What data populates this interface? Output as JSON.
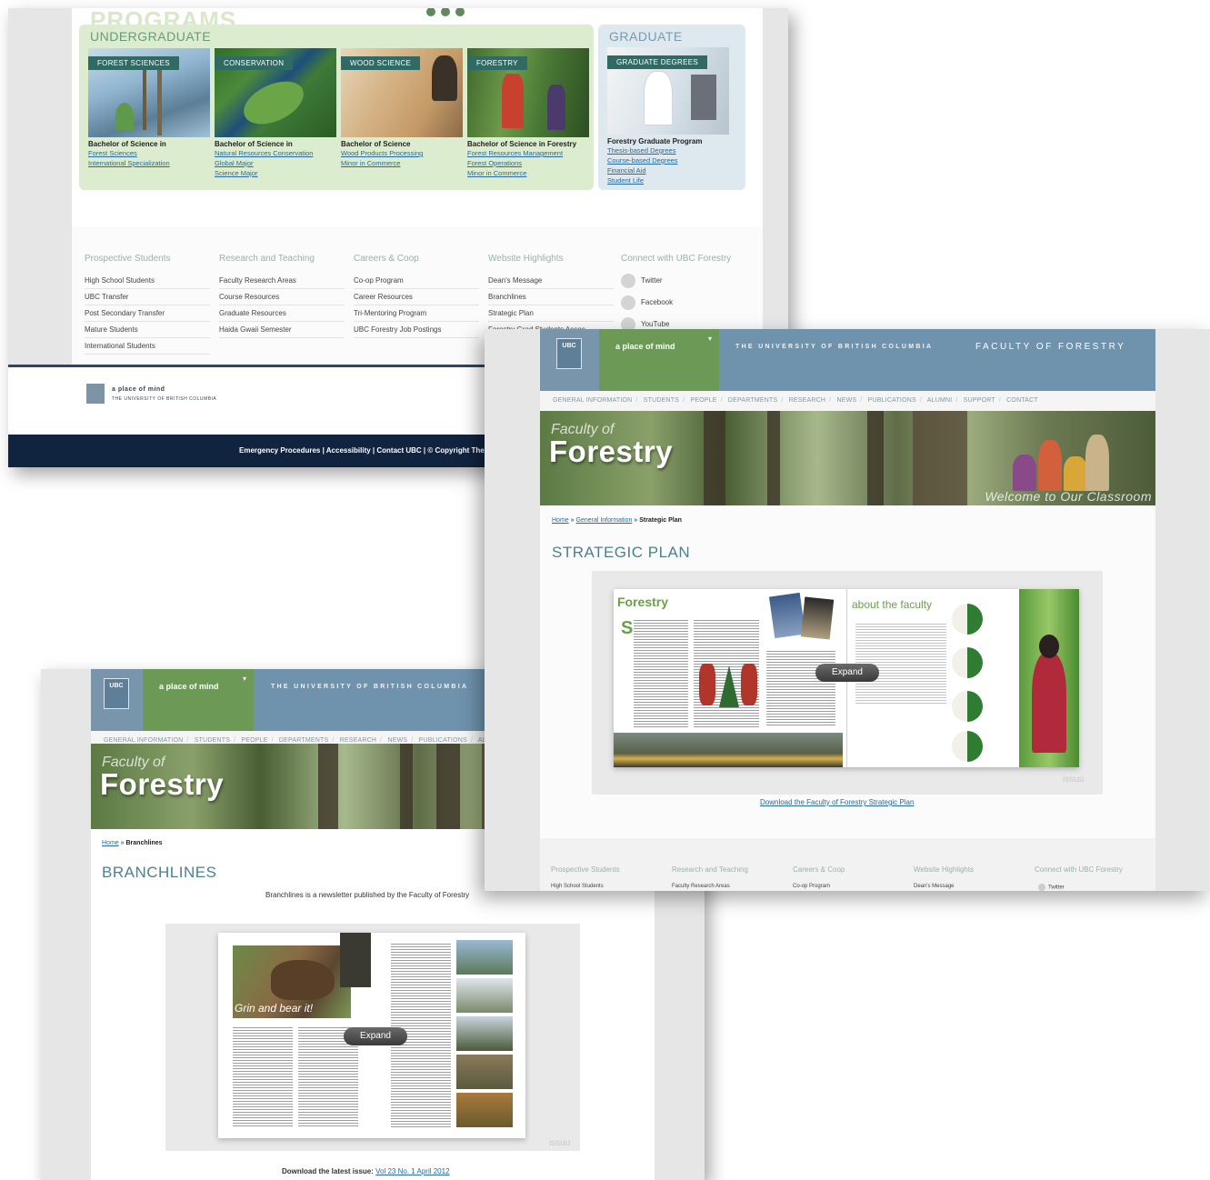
{
  "screen1": {
    "programs_heading": "PROGRAMS",
    "undergraduate": {
      "heading": "UNDERGRADUATE",
      "programs": [
        {
          "tag": "FOREST SCIENCES",
          "title": "Bachelor of Science in",
          "links": [
            "Forest Sciences",
            "International Specialization"
          ]
        },
        {
          "tag": "CONSERVATION",
          "title": "Bachelor of Science in",
          "links": [
            "Natural Resources Conservation",
            "Global Major",
            "Science Major"
          ]
        },
        {
          "tag": "WOOD SCIENCE",
          "title": "Bachelor of Science",
          "links": [
            "Wood Products Processing",
            "Minor in Commerce"
          ]
        },
        {
          "tag": "FORESTRY",
          "title": "Bachelor of Science in Forestry",
          "links": [
            "Forest Resources Management",
            "Forest Operations",
            "Minor in Commerce"
          ]
        }
      ]
    },
    "graduate": {
      "heading": "GRADUATE",
      "tag": "GRADUATE DEGREES",
      "title": "Forestry Graduate Program",
      "links": [
        "Thesis-based Degrees",
        "Course-based Degrees",
        "Financial Aid",
        "Student Life"
      ]
    },
    "footer_columns": [
      {
        "heading": "Prospective Students",
        "items": [
          "High School Students",
          "UBC Transfer",
          "Post Secondary Transfer",
          "Mature Students",
          "International Students"
        ]
      },
      {
        "heading": "Research and Teaching",
        "items": [
          "Faculty Research Areas",
          "Course Resources",
          "Graduate Resources",
          "Haida Gwaii Semester"
        ]
      },
      {
        "heading": "Careers & Coop",
        "items": [
          "Co-op Program",
          "Career Resources",
          "Tri-Mentoring Program",
          "UBC Forestry Job Postings"
        ]
      },
      {
        "heading": "Website Highlights",
        "items": [
          "Dean's Message",
          "Branchlines",
          "Strategic Plan",
          "Forestry Grad Students Assoc."
        ]
      },
      {
        "heading": "Connect with UBC Forestry",
        "social": [
          {
            "label": "Twitter",
            "icon": "twitter-icon"
          },
          {
            "label": "Facebook",
            "icon": "facebook-icon"
          },
          {
            "label": "YouTube",
            "icon": "youtube-icon"
          }
        ]
      }
    ],
    "bottom_logo_line1": "a place of mind",
    "bottom_logo_line2": "THE UNIVERSITY OF BRITISH COLUMBIA",
    "bottom_bar_text": "Emergency Procedures | Accessibility | Contact UBC | © Copyright The U"
  },
  "screen2": {
    "ubc_crest": "UBC",
    "place_of_mind": "a place of mind",
    "university": "THE UNIVERSITY OF BRITISH COLUMBIA",
    "faculty": "FACULTY OF FORESTRY",
    "nav": [
      "GENERAL INFORMATION",
      "STUDENTS",
      "PEOPLE",
      "DEPARTMENTS",
      "RESEARCH",
      "NEWS",
      "PUBLICATIONS",
      "ALUMNI",
      "SUPPORT",
      "CONTACT"
    ],
    "banner_small": "Faculty of",
    "banner_big": "Forestry",
    "banner_tagline": "Welcome to Our Classroom",
    "breadcrumb": {
      "home": "Home",
      "sep1": "»",
      "section": "General Information",
      "sep2": "»",
      "current": "Strategic Plan"
    },
    "page_title": "STRATEGIC PLAN",
    "doc_heading_left": "Forestry",
    "doc_heading_right": "about the faculty",
    "expand_label": "Expand",
    "issuu_label": "issuu",
    "download_link": "Download the Faculty of Forestry Strategic Plan",
    "footer_headings": [
      "Prospective Students",
      "Research and Teaching",
      "Careers & Coop",
      "Website Highlights",
      "Connect with UBC Forestry"
    ],
    "footer_first_items": [
      "High School Students",
      "Faculty Research Areas",
      "Co-op Program",
      "Dean's Message",
      "Twitter"
    ]
  },
  "screen3": {
    "ubc_crest": "UBC",
    "place_of_mind": "a place of mind",
    "university": "THE UNIVERSITY OF BRITISH COLUMBIA",
    "nav": [
      "GENERAL INFORMATION",
      "STUDENTS",
      "PEOPLE",
      "DEPARTMENTS",
      "RESEARCH",
      "NEWS",
      "PUBLICATIONS",
      "ALUMNI"
    ],
    "banner_small": "Faculty of",
    "banner_big": "Forestry",
    "breadcrumb": {
      "home": "Home",
      "sep": "»",
      "current": "Branchlines"
    },
    "page_title": "BRANCHLINES",
    "intro": "Branchlines is a newsletter published by the Faculty of Forestry",
    "doc_caption": "Grin and bear it!",
    "expand_label": "Expand",
    "issuu_label": "issuu",
    "download_prefix": "Download the latest issue:",
    "download_link": "Vol 23 No. 1 April 2012"
  }
}
